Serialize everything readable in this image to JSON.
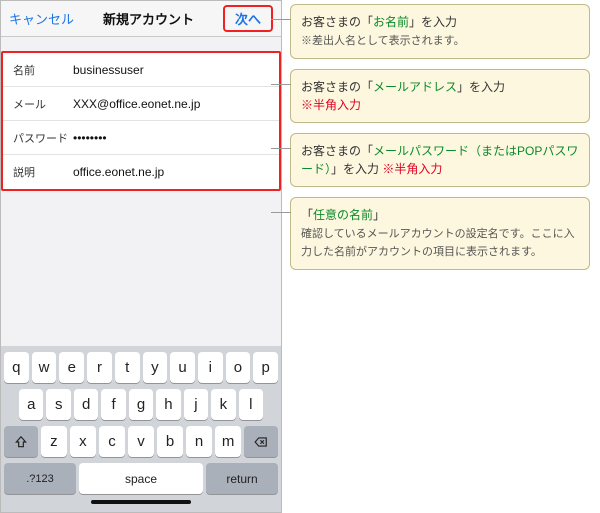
{
  "nav": {
    "cancel": "キャンセル",
    "title": "新規アカウント",
    "next": "次へ"
  },
  "form": {
    "name_lbl": "名前",
    "name_val": "businessuser",
    "mail_lbl": "メール",
    "mail_val": "XXX@office.eonet.ne.jp",
    "pass_lbl": "パスワード",
    "pass_val": "••••••••",
    "desc_lbl": "説明",
    "desc_val": "office.eonet.ne.jp"
  },
  "kb": {
    "r1": [
      "q",
      "w",
      "e",
      "r",
      "t",
      "y",
      "u",
      "i",
      "o",
      "p"
    ],
    "r2": [
      "a",
      "s",
      "d",
      "f",
      "g",
      "h",
      "j",
      "k",
      "l"
    ],
    "r3": [
      "z",
      "x",
      "c",
      "v",
      "b",
      "n",
      "m"
    ],
    "num": ".?123",
    "space": "space",
    "return": "return"
  },
  "callouts": {
    "c1a": "お客さまの「",
    "c1b": "お名前",
    "c1c": "」を入力",
    "c1n": "※差出人名として表示されます。",
    "c2a": "お客さまの「",
    "c2b": "メールアドレス",
    "c2c": "」を入力",
    "c2n": "※半角入力",
    "c3a": "お客さまの「",
    "c3b": "メールパスワード（またはPOPパスワード）",
    "c3c": "」を入力 ",
    "c3n": "※半角入力",
    "c4a": "「",
    "c4b": "任意の名前",
    "c4c": "」",
    "c4n": "確認しているメールアカウントの設定名です。ここに入力した名前がアカウントの項目に表示されます。"
  }
}
